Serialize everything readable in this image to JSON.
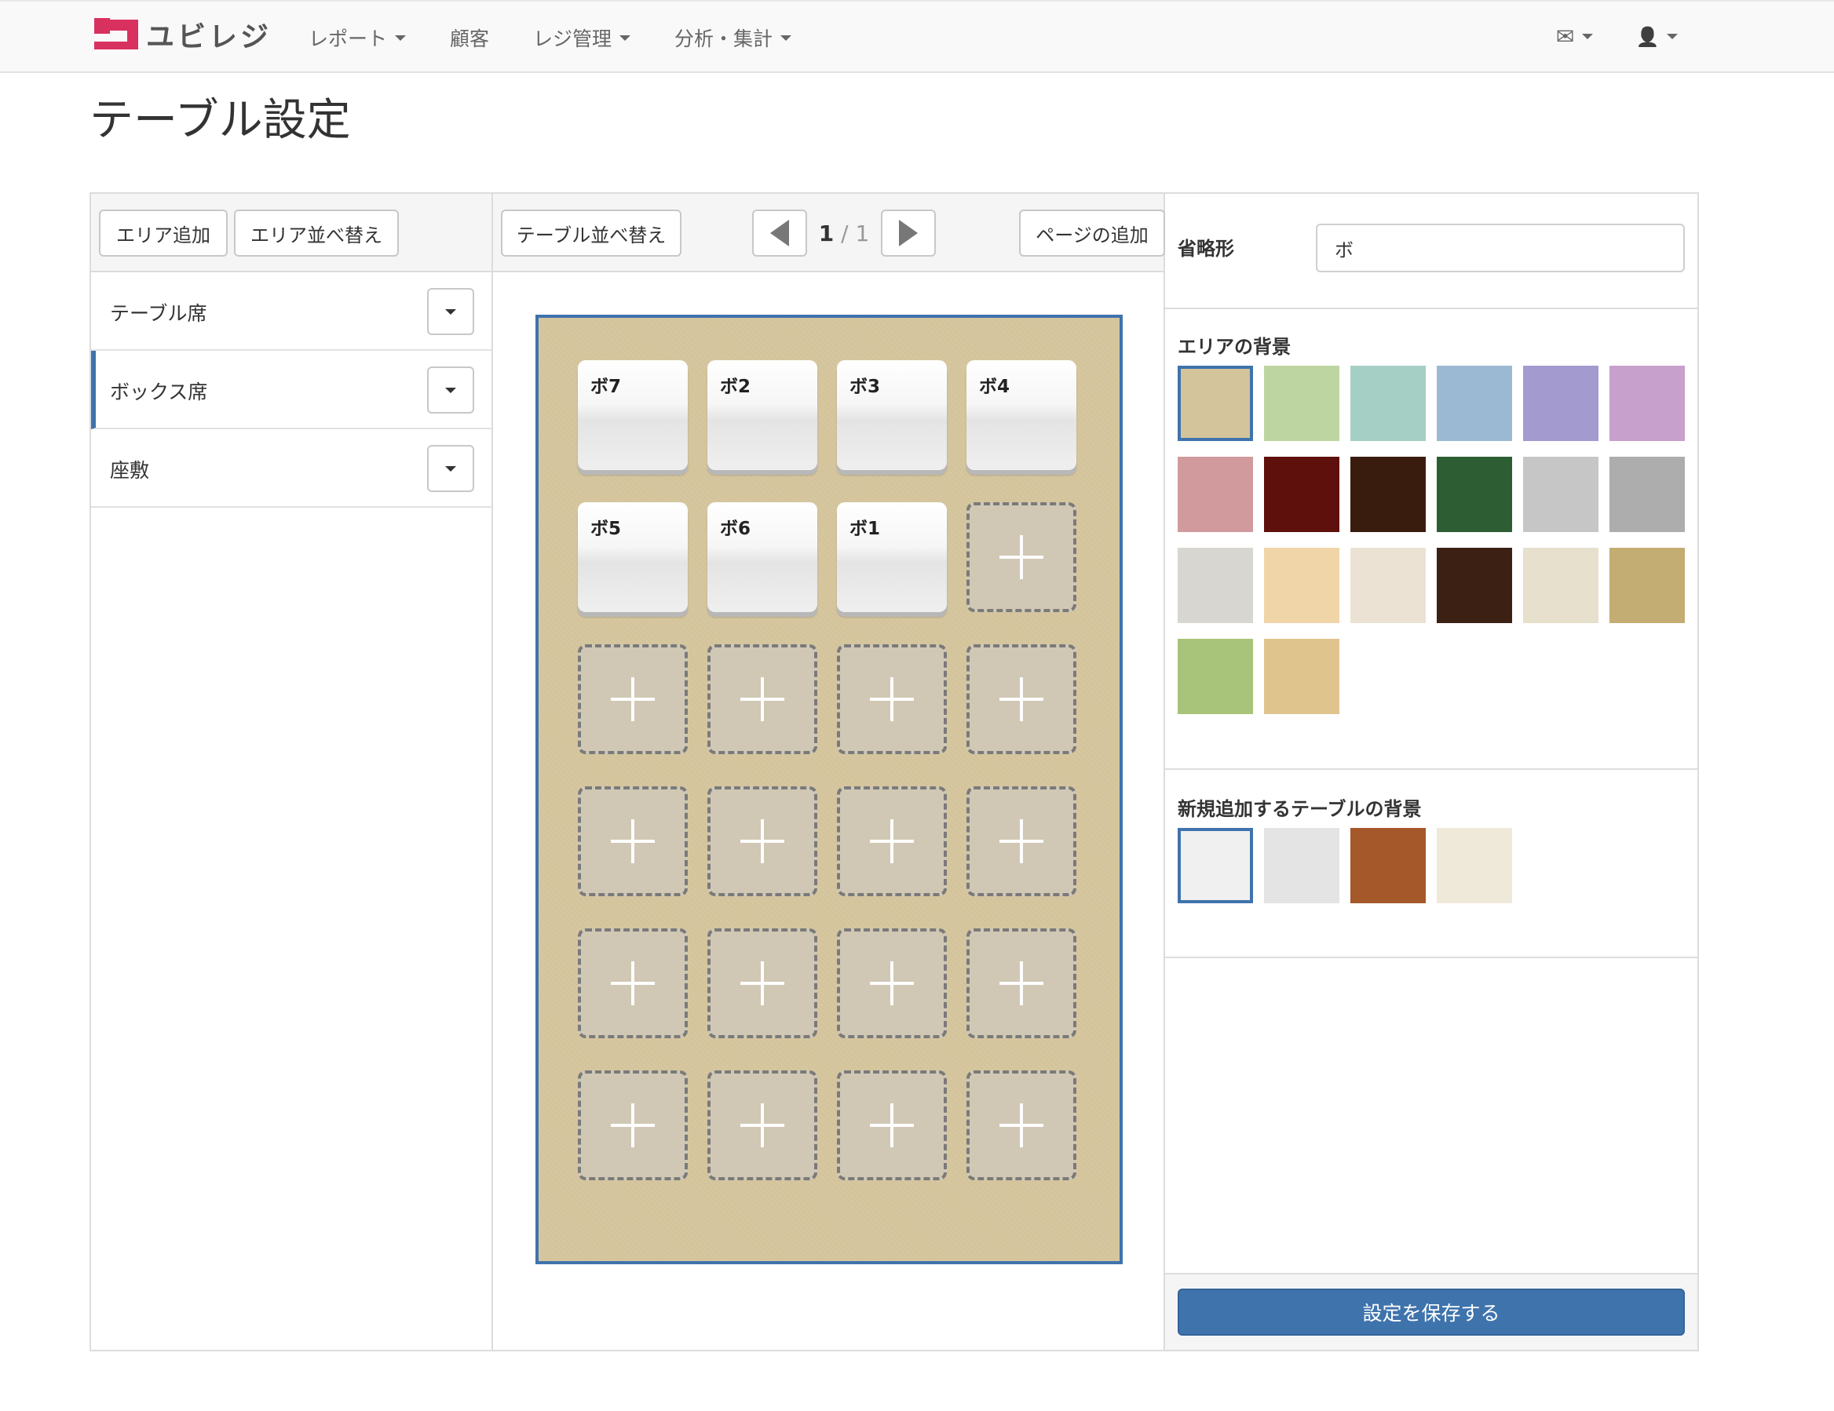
{
  "brand": {
    "name": "ユビレジ",
    "color": "#d9315f"
  },
  "nav": {
    "items": [
      {
        "label": "レポート",
        "dropdown": true
      },
      {
        "label": "顧客",
        "dropdown": false
      },
      {
        "label": "レジ管理",
        "dropdown": true
      },
      {
        "label": "分析・集計",
        "dropdown": true
      }
    ],
    "right": [
      {
        "icon": "mail-icon",
        "glyph": "✉"
      },
      {
        "icon": "user-icon",
        "glyph": "👤"
      }
    ]
  },
  "page": {
    "title": "テーブル設定"
  },
  "left": {
    "add_area": "エリア追加",
    "sort_area": "エリア並べ替え",
    "areas": [
      {
        "label": "テーブル席",
        "active": false
      },
      {
        "label": "ボックス席",
        "active": true
      },
      {
        "label": "座敷",
        "active": false
      }
    ]
  },
  "middle": {
    "sort_tables": "テーブル並べ替え",
    "add_page": "ページの追加",
    "page_current": "1",
    "page_sep": "/",
    "page_total": "1",
    "tables": [
      "ボ7",
      "ボ2",
      "ボ3",
      "ボ4",
      "ボ5",
      "ボ6",
      "ボ1"
    ],
    "grid_columns": 4,
    "grid_rows": 6
  },
  "right": {
    "abbr_label": "省略形",
    "abbr_value": "ボ",
    "area_bg_label": "エリアの背景",
    "area_bg_swatches": [
      "#d4c49c",
      "#bdd5a0",
      "#a5cfc5",
      "#9bb9d2",
      "#a39ad0",
      "#c7a0cc",
      "#d19b9e",
      "#5e100c",
      "#3a1c0f",
      "#2d5e33",
      "#c6c6c6",
      "#adadad",
      "#d8d6d0",
      "#f0d5a8",
      "#ece2d4",
      "#3b2013",
      "#e6e0cc",
      "#c4ad72",
      "#a8c47a",
      "#dfc48e"
    ],
    "area_bg_selected": 0,
    "table_bg_label": "新規追加するテーブルの背景",
    "table_bg_swatches": [
      "#f0f0f0",
      "#e4e4e4",
      "#a5582a",
      "#eee9d8"
    ],
    "table_bg_selected": 0,
    "save_label": "設定を保存する"
  },
  "colors": {
    "accent": "#3f73ac"
  }
}
